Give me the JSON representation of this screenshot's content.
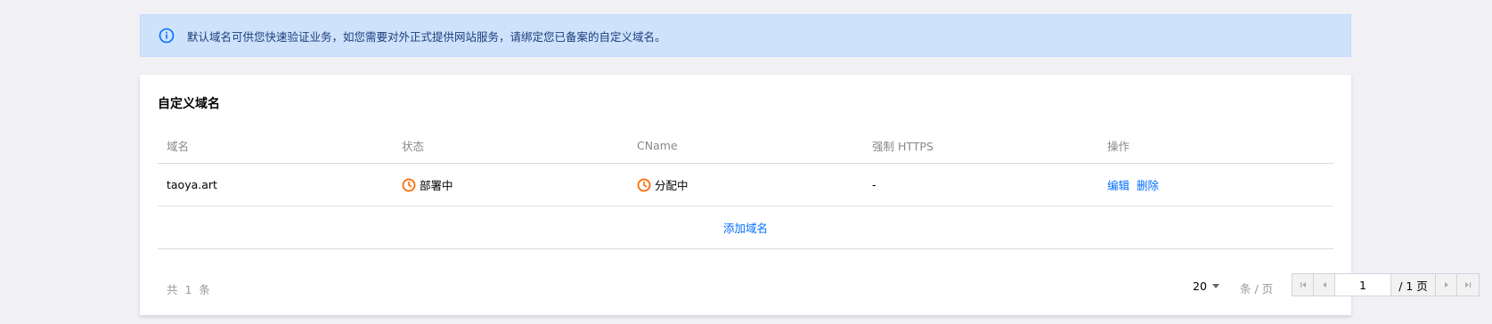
{
  "notice": {
    "text": "默认域名可供您快速验证业务，如您需要对外正式提供网站服务，请绑定您已备案的自定义域名。",
    "color": "#006eff"
  },
  "card": {
    "title": "自定义域名"
  },
  "table": {
    "columns": [
      "域名",
      "状态",
      "CName",
      "强制 HTTPS",
      "操作"
    ],
    "rows": [
      {
        "domain": "taoya.art",
        "status": "部署中",
        "cname": "分配中",
        "https": "-",
        "actions": [
          "编辑",
          "删除"
        ]
      }
    ],
    "add_label": "添加域名"
  },
  "footer": {
    "total": "共 1 条",
    "page_size": "20",
    "per_page_label": "条 / 页",
    "current_page": "1",
    "total_pages": "/ 1 页"
  },
  "colors": {
    "link": "#006eff",
    "status": "#ff6a00",
    "notice_bg": "#cfe2fc"
  }
}
